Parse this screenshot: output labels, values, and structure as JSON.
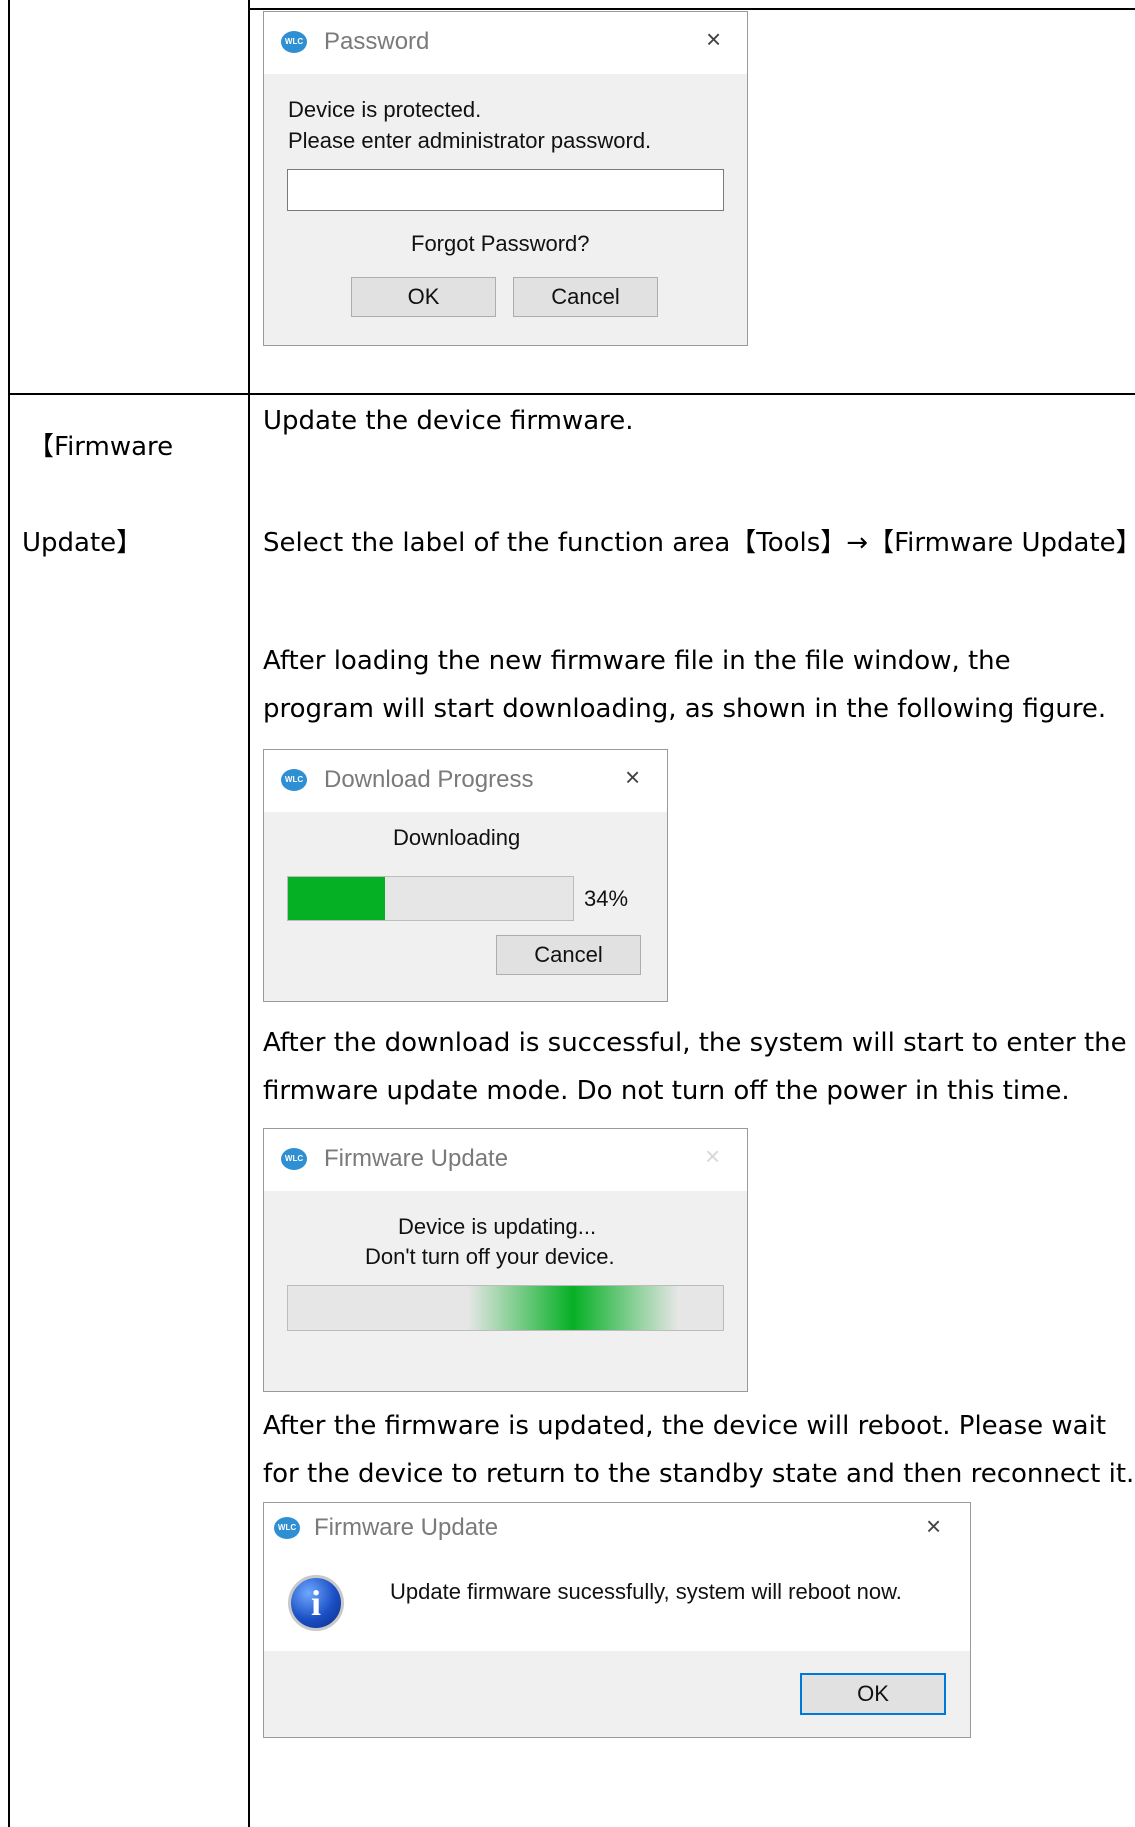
{
  "left_column": {
    "label_line1": "【Firmware",
    "label_line2": "Update】"
  },
  "content": {
    "p1": "Update the device firmware.",
    "p2": "Select the label of the function area【Tools】→【Firmware Update】.",
    "p3_line1": "After loading the new firmware file in the file window, the",
    "p3_line2": "program will start downloading, as shown in the following figure.",
    "p4_line1": "After the download is successful, the system will start to enter the",
    "p4_line2": "firmware update mode. Do not turn off the power in this time.",
    "p5_line1": "After the firmware is updated, the device will reboot. Please wait",
    "p5_line2": "for the device to return to the standby state and then reconnect it."
  },
  "password_dialog": {
    "title": "Password",
    "logo_text": "WLC",
    "message_line1": "Device is protected.",
    "message_line2": "Please enter administrator password.",
    "password_value": "",
    "forgot_link": "Forgot Password?",
    "ok_label": "OK",
    "cancel_label": "Cancel"
  },
  "download_dialog": {
    "title": "Download Progress",
    "logo_text": "WLC",
    "status": "Downloading",
    "progress_percent": 34,
    "progress_label": "34%",
    "cancel_label": "Cancel",
    "progress_color": "#06b025"
  },
  "updating_dialog": {
    "title": "Firmware Update",
    "logo_text": "WLC",
    "message_line1": "Device is updating...",
    "message_line2": "Don't turn off your device."
  },
  "success_dialog": {
    "title": "Firmware Update",
    "logo_text": "WLC",
    "icon": "info-icon",
    "message": "Update firmware sucessfully, system will reboot now.",
    "ok_label": "OK"
  },
  "icons": {
    "close": "×"
  }
}
